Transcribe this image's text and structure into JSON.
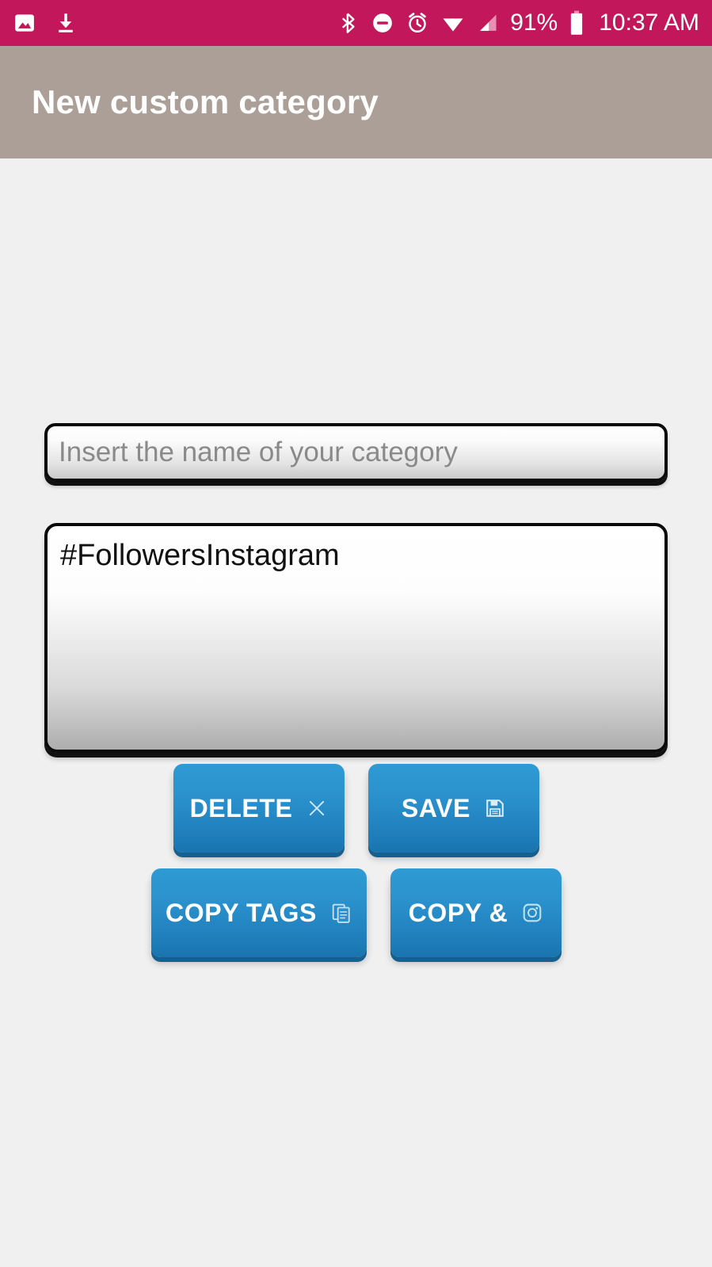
{
  "status_bar": {
    "background_color": "#c2185b",
    "left_icons": [
      {
        "name": "image-icon",
        "label": "image"
      },
      {
        "name": "download-icon",
        "label": "download"
      }
    ],
    "right_icons": [
      {
        "name": "bluetooth-icon",
        "label": "bluetooth"
      },
      {
        "name": "do-not-disturb-icon",
        "label": "do not disturb"
      },
      {
        "name": "alarm-clock-icon",
        "label": "alarm"
      },
      {
        "name": "wifi-icon",
        "label": "wifi"
      },
      {
        "name": "cellular-signal-icon",
        "label": "signal"
      }
    ],
    "battery_percent": "91%",
    "battery_icon": "battery-icon",
    "time": "10:37 AM"
  },
  "app_bar": {
    "title": "New custom category",
    "background_color": "#ab9f98",
    "text_color": "#ffffff"
  },
  "form": {
    "name_input": {
      "value": "",
      "placeholder": "Insert the name of your category"
    },
    "tags_textarea": {
      "value": "#FollowersInstagram",
      "placeholder": ""
    }
  },
  "buttons": {
    "accent_color": "#1f7fbc",
    "rows": [
      [
        {
          "label": "DELETE",
          "icon": "close-icon"
        },
        {
          "label": "SAVE",
          "icon": "floppy-disk-icon"
        }
      ],
      [
        {
          "label": "COPY TAGS",
          "icon": "copy-icon"
        },
        {
          "label": "COPY &",
          "icon": "instagram-icon"
        }
      ]
    ]
  }
}
